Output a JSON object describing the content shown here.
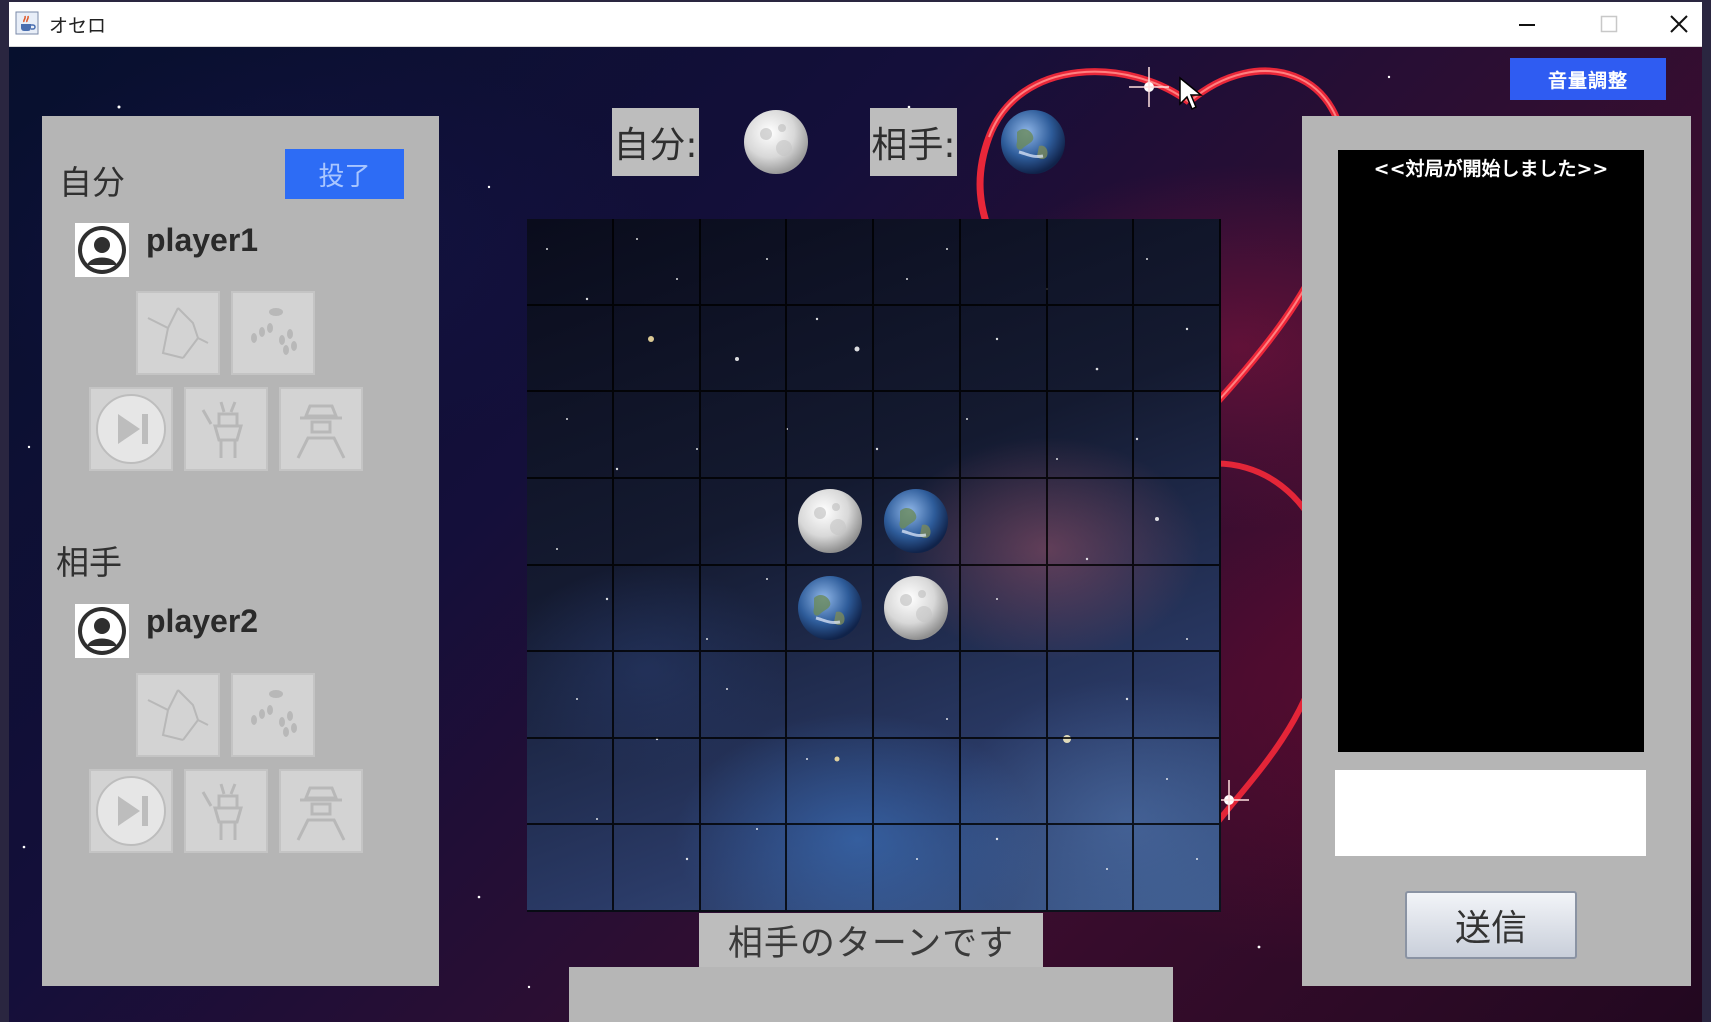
{
  "window": {
    "title": "オセロ",
    "app_icon": "java-cup-icon",
    "controls": [
      "minimize-icon",
      "maximize-icon",
      "close-icon"
    ]
  },
  "toolbar": {
    "volume_label": "音量調整"
  },
  "left_panel": {
    "self_label": "自分",
    "resign_label": "投了",
    "self_player_name": "player1",
    "opponent_label": "相手",
    "opponent_player_name": "player2",
    "item_icons": [
      "cracked-board-icon",
      "scatter-icon",
      "skip-turn-icon",
      "devil-icon",
      "hat-man-icon"
    ]
  },
  "score_bar": {
    "self_label": "自分:",
    "self_disc": "moon",
    "opponent_label": "相手:",
    "opponent_disc": "earth"
  },
  "board": {
    "size": 8,
    "pieces": [
      {
        "row": 3,
        "col": 3,
        "type": "moon"
      },
      {
        "row": 3,
        "col": 4,
        "type": "earth"
      },
      {
        "row": 4,
        "col": 3,
        "type": "earth"
      },
      {
        "row": 4,
        "col": 4,
        "type": "moon"
      }
    ]
  },
  "status": {
    "turn_text": "相手のターンです"
  },
  "chat": {
    "messages": [
      "<<対局が開始しました>>"
    ],
    "input_value": "",
    "send_label": "送信"
  },
  "colors": {
    "accent_blue": "#2f5cf2",
    "panel_gray": "#b5b5b5"
  }
}
